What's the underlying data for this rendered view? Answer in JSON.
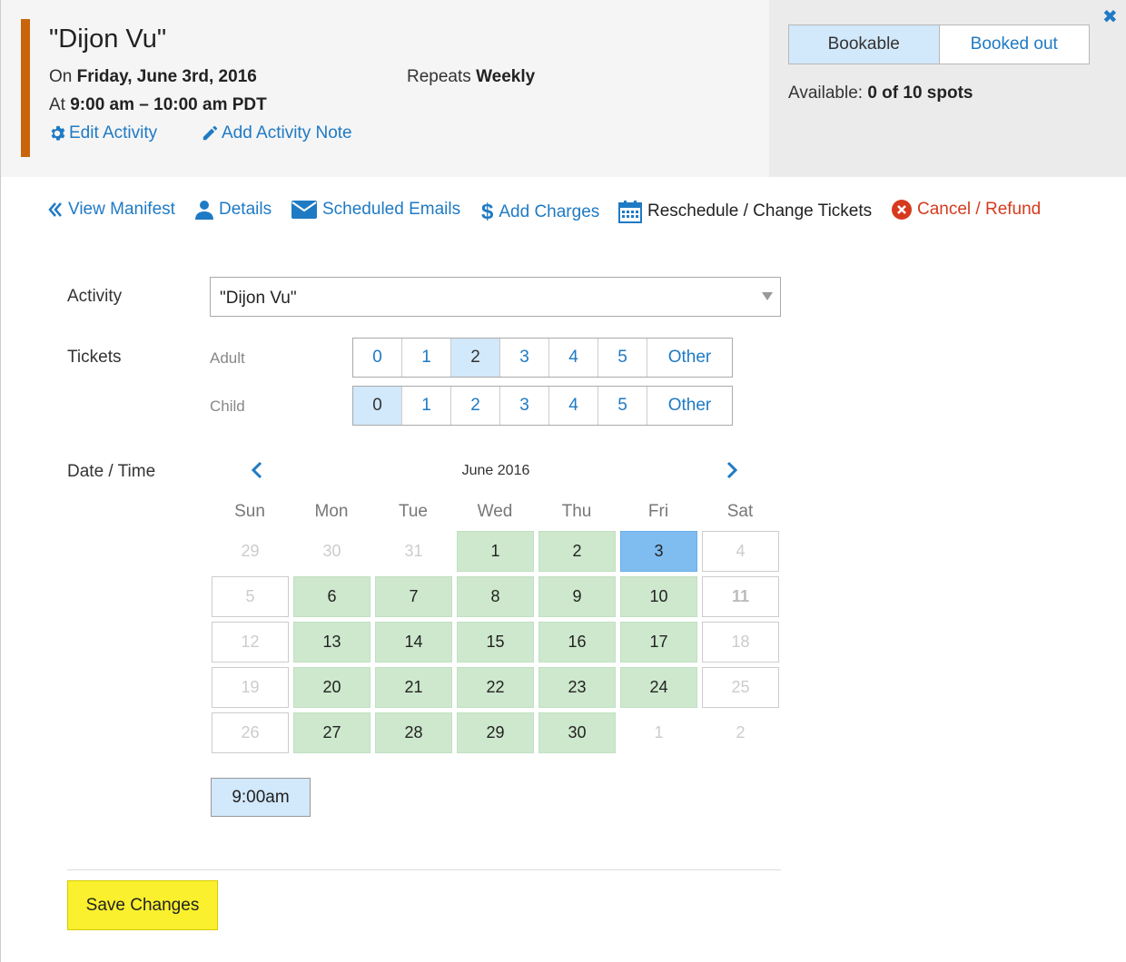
{
  "header": {
    "title": "\"Dijon Vu\"",
    "date_prefix": "On",
    "date": "Friday, June 3rd, 2016",
    "repeats_prefix": "Repeats",
    "repeats": "Weekly",
    "time_prefix": "At",
    "time": "9:00 am – 10:00 am PDT",
    "edit_activity": "Edit Activity",
    "add_note": "Add Activity Note",
    "toggle_bookable": "Bookable",
    "toggle_booked_out": "Booked out",
    "available_label": "Available:",
    "available_value": "0 of 10 spots",
    "accent_color": "#c8650a"
  },
  "nav": {
    "view_manifest": "View Manifest",
    "details": "Details",
    "scheduled_emails": "Scheduled Emails",
    "add_charges": "Add Charges",
    "reschedule": "Reschedule / Change Tickets",
    "cancel_refund": "Cancel / Refund"
  },
  "form": {
    "activity_label": "Activity",
    "activity_value": "\"Dijon Vu\"",
    "tickets_label": "Tickets",
    "adult_label": "Adult",
    "child_label": "Child",
    "ticket_options": [
      "0",
      "1",
      "2",
      "3",
      "4",
      "5",
      "Other"
    ],
    "adult_selected": "2",
    "child_selected": "0",
    "datetime_label": "Date / Time"
  },
  "calendar": {
    "month": "June 2016",
    "weekdays": [
      "Sun",
      "Mon",
      "Tue",
      "Wed",
      "Thu",
      "Fri",
      "Sat"
    ],
    "weeks": [
      [
        {
          "d": "29",
          "s": "plain"
        },
        {
          "d": "30",
          "s": "plain"
        },
        {
          "d": "31",
          "s": "plain"
        },
        {
          "d": "1",
          "s": "avail"
        },
        {
          "d": "2",
          "s": "avail"
        },
        {
          "d": "3",
          "s": "sel"
        },
        {
          "d": "4",
          "s": "box"
        }
      ],
      [
        {
          "d": "5",
          "s": "box"
        },
        {
          "d": "6",
          "s": "avail"
        },
        {
          "d": "7",
          "s": "avail"
        },
        {
          "d": "8",
          "s": "avail"
        },
        {
          "d": "9",
          "s": "avail"
        },
        {
          "d": "10",
          "s": "avail"
        },
        {
          "d": "11",
          "s": "boxdark"
        }
      ],
      [
        {
          "d": "12",
          "s": "box"
        },
        {
          "d": "13",
          "s": "avail"
        },
        {
          "d": "14",
          "s": "avail"
        },
        {
          "d": "15",
          "s": "avail"
        },
        {
          "d": "16",
          "s": "avail"
        },
        {
          "d": "17",
          "s": "avail"
        },
        {
          "d": "18",
          "s": "box"
        }
      ],
      [
        {
          "d": "19",
          "s": "box"
        },
        {
          "d": "20",
          "s": "avail"
        },
        {
          "d": "21",
          "s": "avail"
        },
        {
          "d": "22",
          "s": "avail"
        },
        {
          "d": "23",
          "s": "avail"
        },
        {
          "d": "24",
          "s": "avail"
        },
        {
          "d": "25",
          "s": "box"
        }
      ],
      [
        {
          "d": "26",
          "s": "box"
        },
        {
          "d": "27",
          "s": "avail"
        },
        {
          "d": "28",
          "s": "avail"
        },
        {
          "d": "29",
          "s": "avail"
        },
        {
          "d": "30",
          "s": "avail"
        },
        {
          "d": "1",
          "s": "plain"
        },
        {
          "d": "2",
          "s": "plain"
        }
      ]
    ],
    "time_slot": "9:00am"
  },
  "actions": {
    "save": "Save Changes"
  }
}
